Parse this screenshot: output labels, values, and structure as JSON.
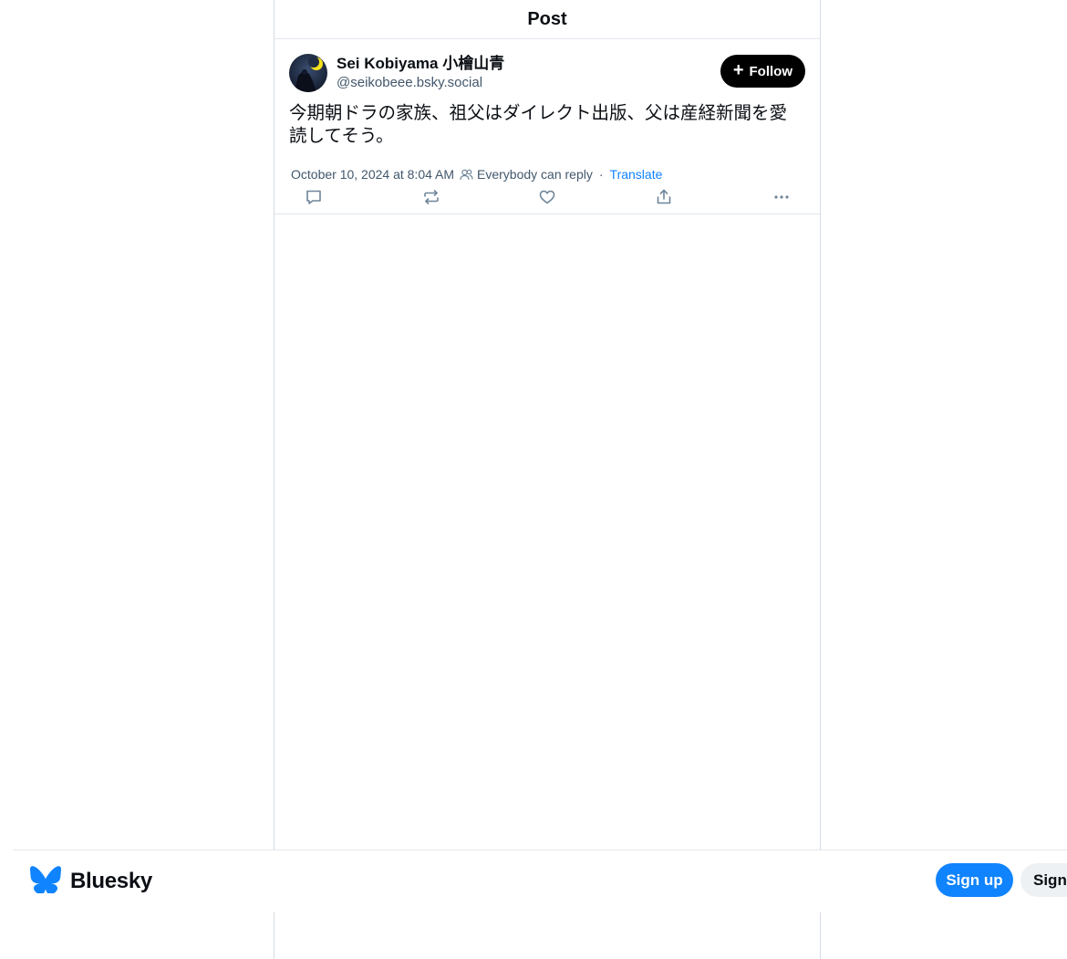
{
  "header": {
    "title": "Post"
  },
  "post": {
    "author": {
      "display_name": "Sei Kobiyama 小檜山青",
      "handle": "@seikobeee.bsky.social"
    },
    "follow_label": "Follow",
    "text": "今期朝ドラの家族、祖父はダイレクト出版、父は産経新聞を愛読してそう。",
    "timestamp": "October 10, 2024 at 8:04 AM",
    "reply_setting": "Everybody can reply",
    "separator": "·",
    "translate_label": "Translate",
    "actions": {
      "reply_icon": "reply-icon",
      "repost_icon": "repost-icon",
      "like_icon": "heart-icon",
      "share_icon": "share-icon",
      "more_icon": "more-icon"
    }
  },
  "bottom_bar": {
    "brand_name": "Bluesky",
    "signup_label": "Sign up",
    "signin_label": "Sign in"
  },
  "colors": {
    "accent": "#1083fe",
    "text_primary": "#0b0f14",
    "text_secondary": "#42576c",
    "border": "#e2e7ec"
  }
}
